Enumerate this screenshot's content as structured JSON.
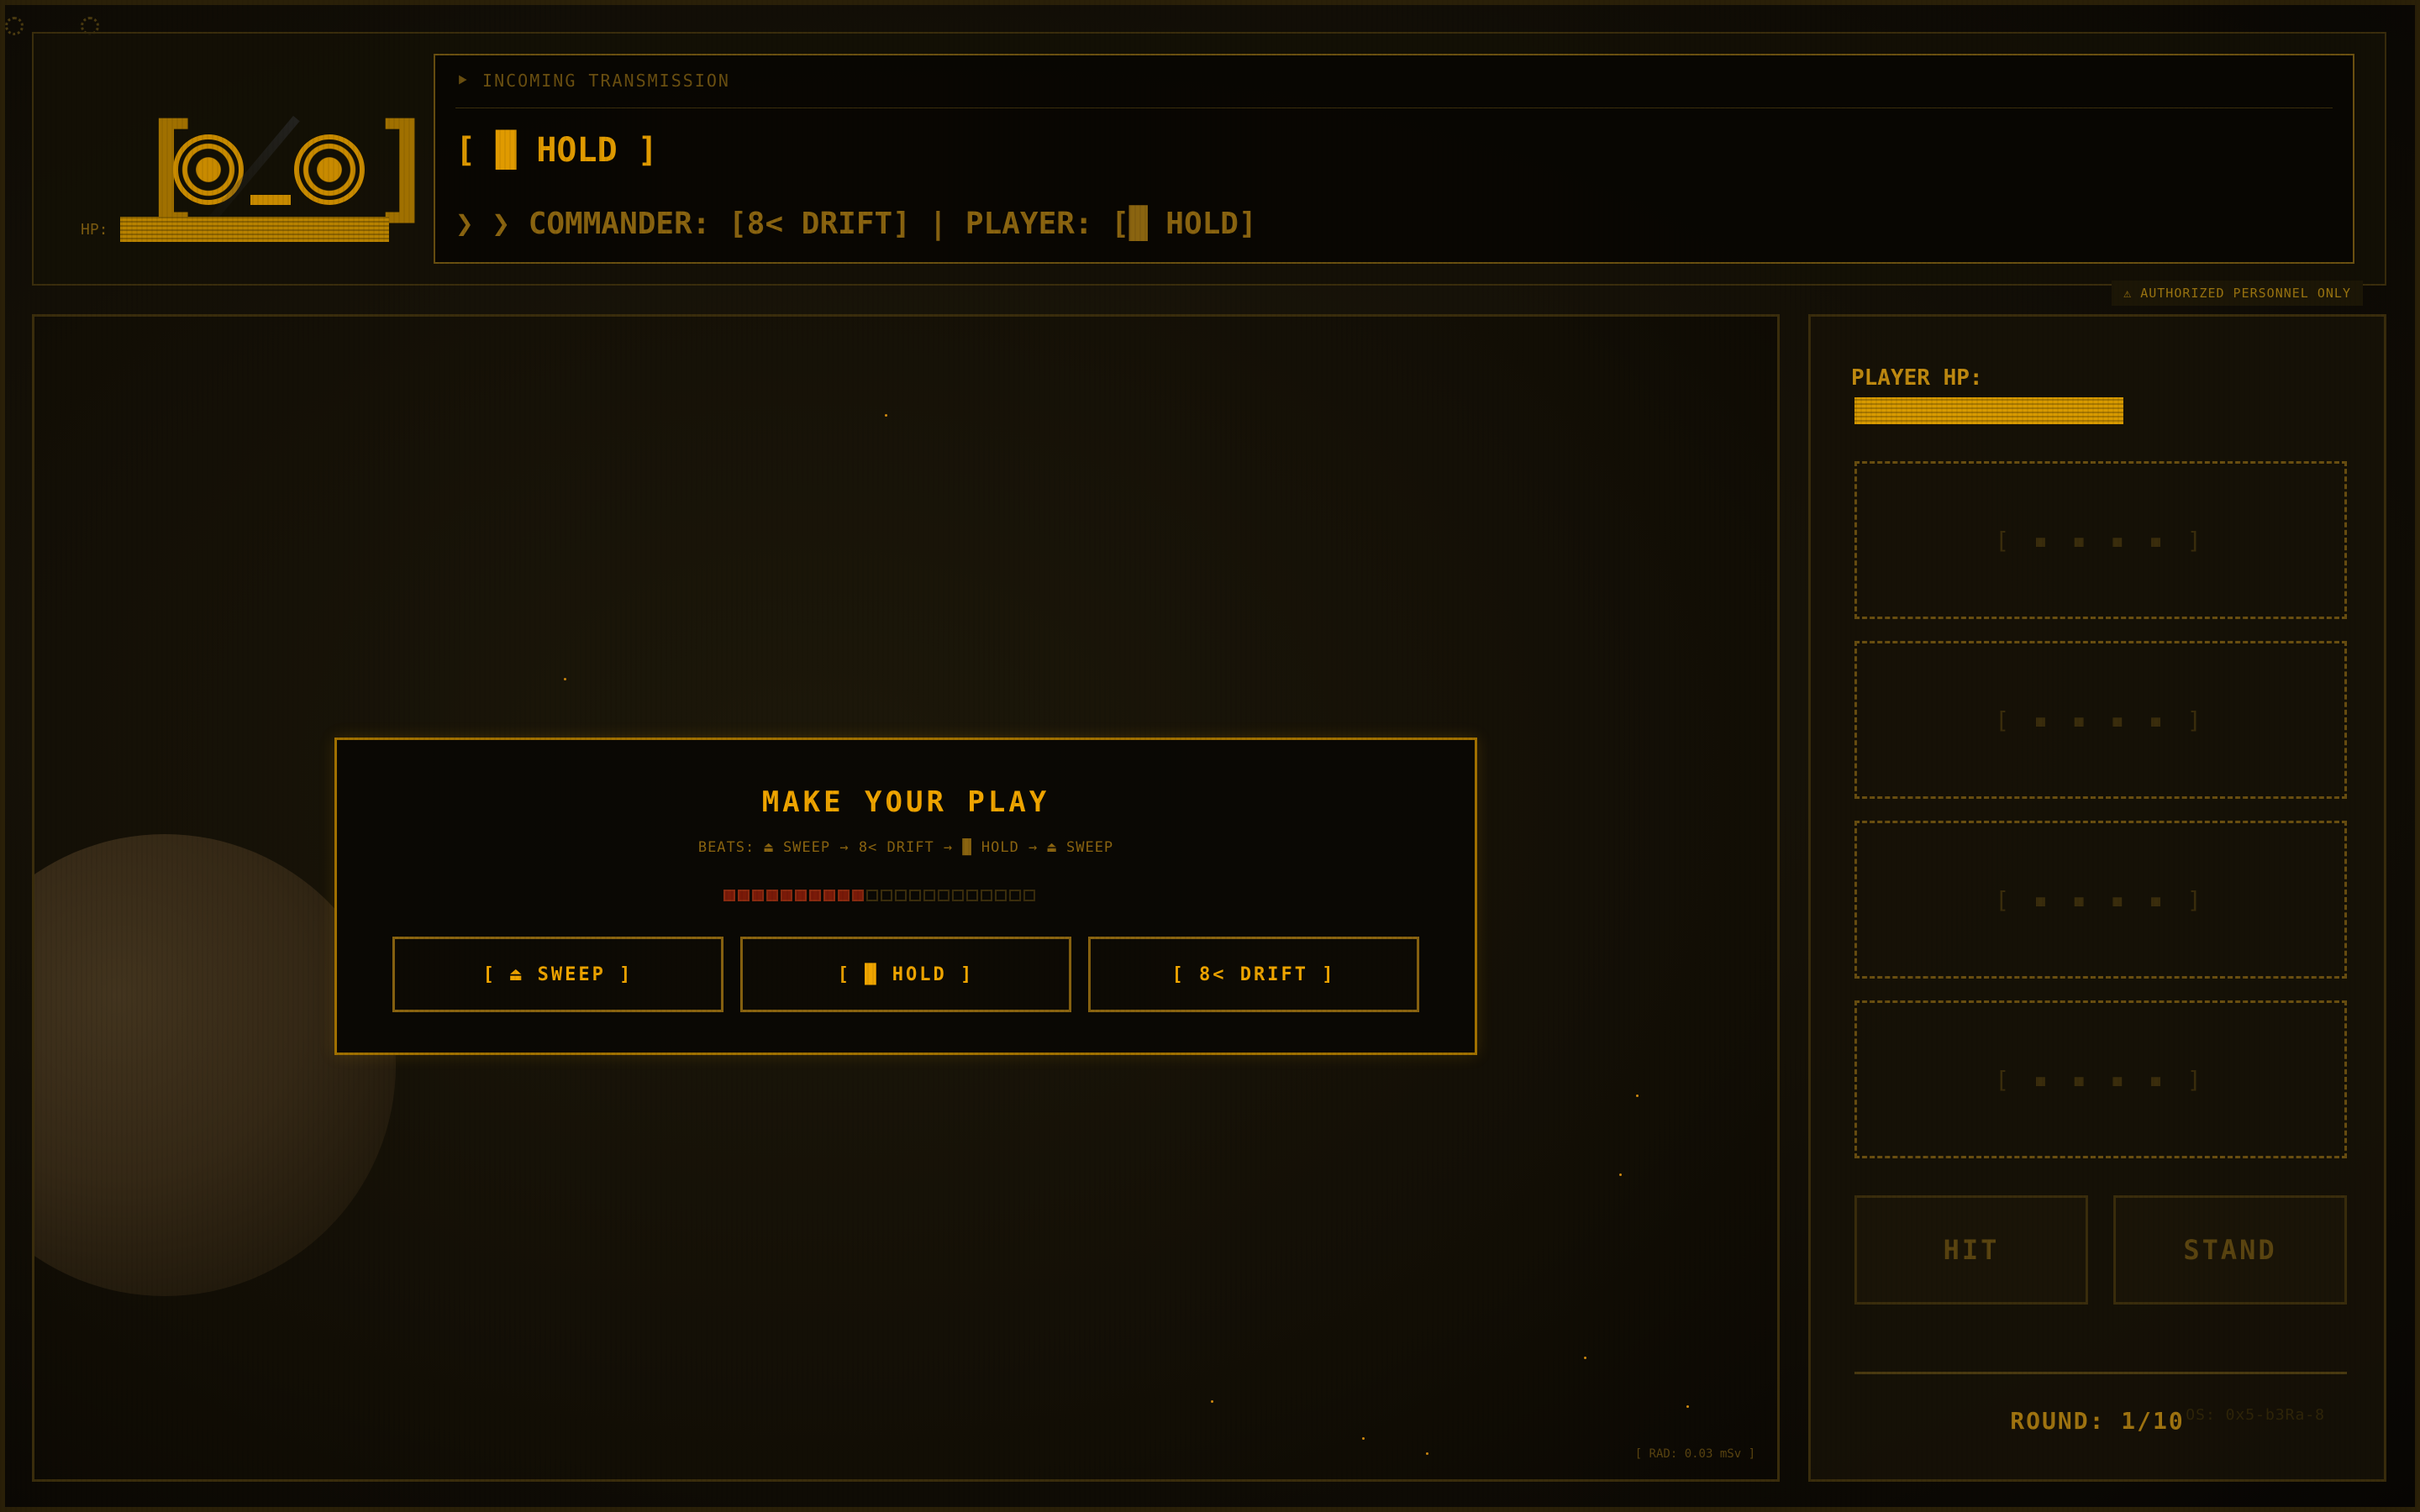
{
  "header": {
    "face": {
      "left_bracket": "[",
      "right_bracket": "]"
    },
    "hp_label": "HP:",
    "transmission_title": "⯈ INCOMING TRANSMISSION",
    "current_move": "[ █ HOLD ]",
    "status": "❯ ❯ COMMANDER: [8< DRIFT] | PLAYER: [█ HOLD]",
    "auth_badge": "⚠ AUTHORIZED PERSONNEL ONLY"
  },
  "modal": {
    "title": "MAKE YOUR PLAY",
    "subtitle": "BEATS: ⏏ SWEEP → 8< DRIFT → █ HOLD → ⏏ SWEEP",
    "timer": {
      "filled": 10,
      "total": 22
    },
    "choices": [
      {
        "label": "[ ⏏ SWEEP ]"
      },
      {
        "label": "[ █ HOLD ]"
      },
      {
        "label": "[ 8< DRIFT ]"
      }
    ]
  },
  "field": {
    "rad_readout": "[ RAD: 0.03 mSv ]"
  },
  "panel": {
    "player_hp_label": "PLAYER HP:",
    "slots": [
      "[ ▪ ▪ ▪ ▪ ]",
      "[ ▪ ▪ ▪ ▪ ]",
      "[ ▪ ▪ ▪ ▪ ]",
      "[ ▪ ▪ ▪ ▪ ]"
    ],
    "hit_label": "HIT",
    "stand_label": "STAND",
    "round_label": "ROUND: 1/10",
    "version": "OS: 0x5-b3Ra-8"
  },
  "icons": [
    "gear-icon",
    "sweep-icon",
    "hold-icon",
    "drift-icon"
  ],
  "colors": {
    "accent": "#f0a500",
    "dim": "#6a4f10",
    "timer_on": "#7a1a08"
  }
}
